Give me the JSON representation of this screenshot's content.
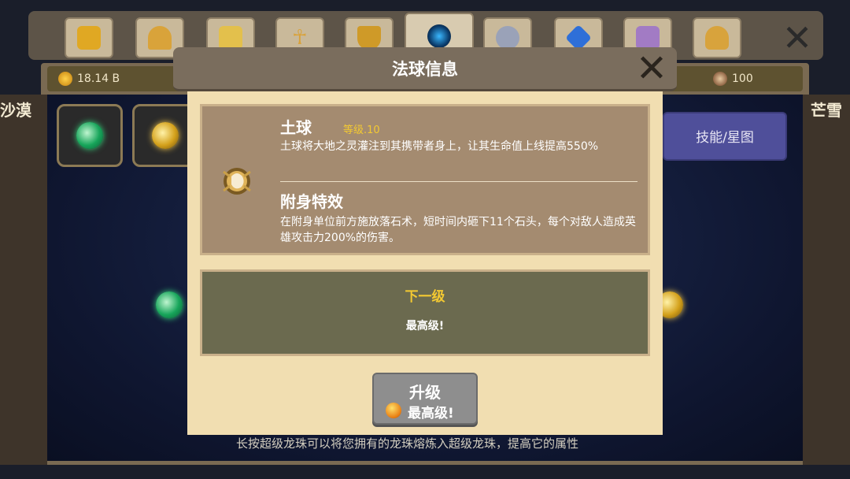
{
  "resources": {
    "gold": "18.14 B",
    "other": "100"
  },
  "background": {
    "left_area_label": "沙漠",
    "right_area_label": "芒雪",
    "skill_button_label": "技能/星图",
    "hint_text": "长按超级龙珠可以将您拥有的龙珠熔炼入超级龙珠，提高它的属性"
  },
  "tabs": [
    {
      "icon": "helmet-icon"
    },
    {
      "icon": "dragon-head-icon"
    },
    {
      "icon": "crown-icon"
    },
    {
      "icon": "ankh-icon"
    },
    {
      "icon": "trophy-icon"
    },
    {
      "icon": "orb-icon"
    },
    {
      "icon": "armor-icon"
    },
    {
      "icon": "gem-icon"
    },
    {
      "icon": "shirt-icon"
    },
    {
      "icon": "hero-icon"
    }
  ],
  "modal": {
    "title": "法球信息",
    "orb_name": "土球",
    "orb_level": "等级.10",
    "orb_description": "土球将大地之灵灌注到其携带者身上，让其生命值上线提高550%",
    "effect_title": "附身特效",
    "effect_description": "在附身单位前方施放落石术，短时间内砸下11个石头，每个对敌人造成英雄攻击力200%的伤害。",
    "next_level_title": "下一级",
    "next_level_value": "最高级!",
    "upgrade_label": "升级",
    "upgrade_cost": "最高级!"
  }
}
